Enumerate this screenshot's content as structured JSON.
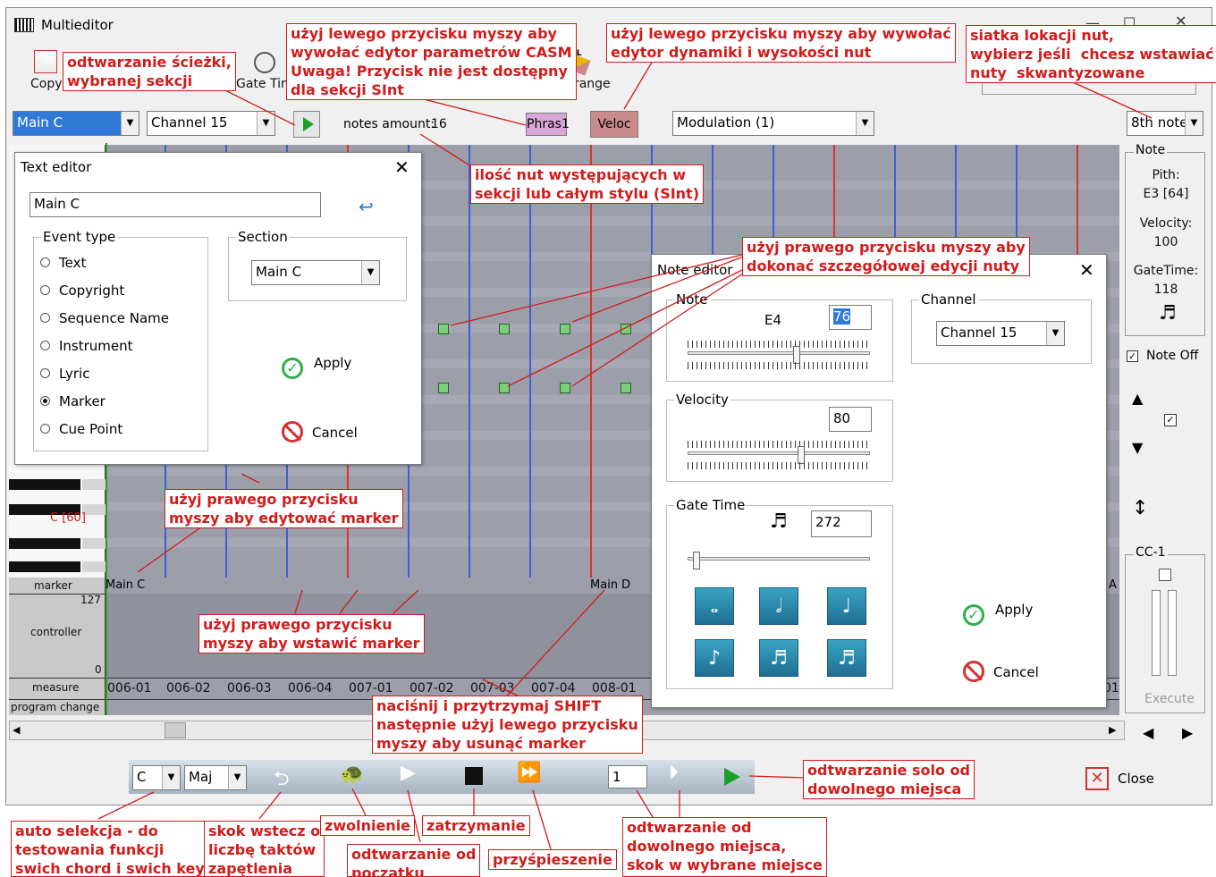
{
  "window": {
    "title": "Multieditor",
    "min": "—",
    "restore": "☐",
    "close": "✕"
  },
  "toolbar": {
    "copy_label": "Copy",
    "gate_label": "Gate Tim",
    "range_label": "t range",
    "all_label": "ALL"
  },
  "controls": {
    "section_select": "Main C",
    "channel_select": "Channel 15",
    "notes_amount_label": "notes amount:",
    "notes_amount_value": "16",
    "phrase_button": "Phras1",
    "velocity_button": "Veloc",
    "controller_select": "Modulation (1)",
    "quantize_select": "8th note"
  },
  "note_panel": {
    "group_label": "Note",
    "pitch_label": "Pith:",
    "pitch_value": "E3 [64]",
    "velocity_label": "Velocity:",
    "velocity_value": "100",
    "gate_label": "GateTime:",
    "gate_value": "118",
    "note_off_label": "Note Off"
  },
  "cc_panel": {
    "label": "CC-1",
    "execute": "Execute"
  },
  "piano": {
    "key_label": "C [60]"
  },
  "lanes": {
    "marker_label": "marker",
    "controller_label": "controller",
    "controller_max": "127",
    "controller_min": "0",
    "measure_label": "measure",
    "program_label": "program change",
    "markers": [
      "Main C",
      "Main D",
      "A"
    ],
    "measures": [
      "006-01",
      "006-02",
      "006-03",
      "006-04",
      "007-01",
      "007-02",
      "007-03",
      "007-04",
      "008-01",
      "01"
    ]
  },
  "text_editor": {
    "title": "Text editor",
    "name_value": "Main C",
    "event_type_label": "Event type",
    "event_types": [
      "Text",
      "Copyright",
      "Sequence Name",
      "Instrument",
      "Lyric",
      "Marker",
      "Cue Point"
    ],
    "selected_event": "Marker",
    "section_label": "Section",
    "section_value": "Main C",
    "apply": "Apply",
    "cancel": "Cancel"
  },
  "note_editor": {
    "title": "Note editor",
    "note_group": "Note",
    "note_name": "E4",
    "note_value": "76",
    "channel_group": "Channel",
    "channel_value": "Channel 15",
    "velocity_group": "Velocity",
    "velocity_value": "80",
    "velocity_level": 0.63,
    "note_level": 0.6,
    "gate_group": "Gate Time",
    "gate_value": "272",
    "gate_level": 0.03,
    "apply": "Apply",
    "cancel": "Cancel"
  },
  "transport": {
    "key_select": "C",
    "mode_select": "Maj",
    "position_value": "1",
    "close_label": "Close"
  },
  "annotations": {
    "play_track": "odtwarzanie ścieżki,\nwybranej sekcji",
    "casm": "użyj lewego przycisku myszy aby\nwywołać edytor parametrów CASM\nUwaga! Przycisk nie jest dostępny\ndla sekcji SInt",
    "dynamics": "użyj lewego przycisku myszy aby wywołać\nedytor dynamiki i wysokości nut",
    "grid": "siatka lokacji nut,\nwybierz jeśli  chcesz wstawiać\nnuty  skwantyzowane",
    "notes_count": "ilość nut występujących w\nsekcji lub całym stylu (SInt)",
    "note_edit": "użyj prawego przycisku myszy aby\ndokonać szczegółowej edycji nuty",
    "marker_edit": "użyj prawego przycisku\nmyszy aby edytować marker",
    "marker_insert": "użyj prawego przycisku\nmyszy aby wstawić marker",
    "marker_delete": "naciśnij i przytrzymaj SHIFT\nnastępnie użyj lewego przycisku\nmyszy aby usunąć marker",
    "solo_play": "odtwarzanie solo od\ndowolnego miejsca",
    "auto_select": "auto selekcja - do\ntestowania funkcji\nswich chord i swich key",
    "skip_back": "skok wstecz o\nliczbę taktów\nzapętlenia",
    "slowdown": "zwolnienie",
    "stop": "zatrzymanie",
    "play_start": "odtwarzanie od\npoczątku",
    "speedup": "przyśpieszenie",
    "play_any": "odtwarzanie od\ndowolnego miejsca,\nskok w wybrane miejsce"
  }
}
